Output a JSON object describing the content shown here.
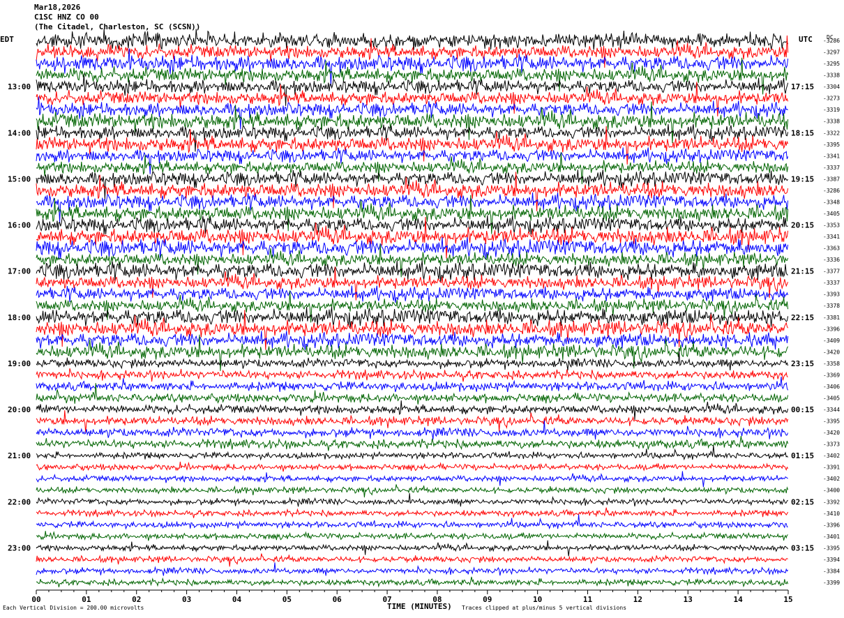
{
  "header": {
    "date": "Mar18,2026",
    "channel": "C1SC HNZ CO 00",
    "station": "(The Citadel, Charleston, SC (SCSN))"
  },
  "left_axis_label": "EDT",
  "right_axis_label": "UTC",
  "dc_label": "DC",
  "footer": {
    "left_note": "Each Vertical Division =  200.00 microvolts",
    "axis_title": "TIME (MINUTES)",
    "right_note": "Traces clipped at plus/minus 5 vertical divisions"
  },
  "colors": {
    "black": "#000000",
    "red": "#ff0000",
    "blue": "#0000ff",
    "green": "#006400"
  },
  "chart_data": {
    "type": "line",
    "title": "Mar18,2026 C1SC HNZ CO 00",
    "xlabel": "TIME (MINUTES)",
    "ylabel": "",
    "xlim": [
      0,
      15
    ],
    "x_ticks": [
      "00",
      "01",
      "02",
      "03",
      "04",
      "05",
      "06",
      "07",
      "08",
      "09",
      "10",
      "11",
      "12",
      "13",
      "14",
      "15"
    ],
    "trace_color_cycle": [
      "black",
      "red",
      "blue",
      "green"
    ],
    "left_hour_labels": [
      "13:00",
      "14:00",
      "15:00",
      "16:00",
      "17:00",
      "18:00",
      "19:00",
      "20:00",
      "21:00",
      "22:00",
      "23:00"
    ],
    "right_hour_labels": [
      "17:15",
      "18:15",
      "19:15",
      "20:15",
      "21:15",
      "22:15",
      "23:15",
      "00:15",
      "01:15",
      "02:15",
      "03:15"
    ],
    "dc_offsets": [
      "-3286",
      "-3297",
      "-3295",
      "-3338",
      "-3304",
      "-3273",
      "-3319",
      "-3338",
      "-3322",
      "-3395",
      "-3341",
      "-3337",
      "-3387",
      "-3286",
      "-3348",
      "-3405",
      "-3353",
      "-3341",
      "-3363",
      "-3336",
      "-3377",
      "-3337",
      "-3393",
      "-3378",
      "-3381",
      "-3396",
      "-3409",
      "-3420",
      "-3358",
      "-3369",
      "-3406",
      "-3405",
      "-3344",
      "-3395",
      "-3420",
      "-3373",
      "-3402",
      "-3391",
      "-3402",
      "-3400",
      "-3392",
      "-3410",
      "-3396",
      "-3401",
      "-3395",
      "-3394",
      "-3384",
      "-3399"
    ],
    "scale": "200.00 microvolts per vertical division",
    "clipping": "plus/minus 5 vertical divisions"
  }
}
